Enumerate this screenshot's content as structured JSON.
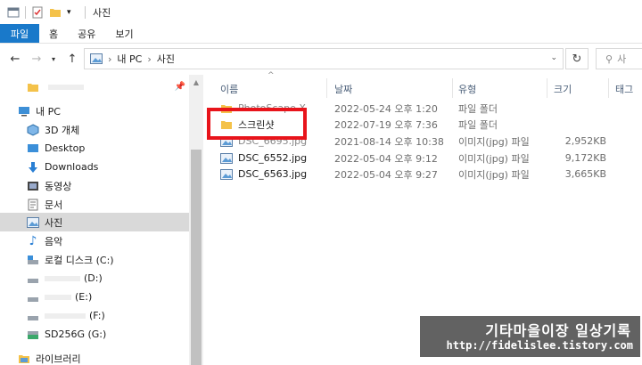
{
  "window": {
    "title": "사진"
  },
  "ribbon": {
    "tabs": [
      "파일",
      "홈",
      "공유",
      "보기"
    ]
  },
  "address": {
    "path": [
      "내 PC",
      "사진"
    ],
    "search_placeholder": "사"
  },
  "nav": {
    "items": [
      {
        "label": "",
        "icon": "folder-icon",
        "pinned": true
      },
      {
        "label": "내 PC",
        "icon": "pc-icon"
      },
      {
        "label": "3D 개체",
        "icon": "3d-objects-icon"
      },
      {
        "label": "Desktop",
        "icon": "desktop-icon"
      },
      {
        "label": "Downloads",
        "icon": "download-icon"
      },
      {
        "label": "동영상",
        "icon": "video-icon"
      },
      {
        "label": "문서",
        "icon": "document-icon"
      },
      {
        "label": "사진",
        "icon": "pictures-icon",
        "selected": true
      },
      {
        "label": "음악",
        "icon": "music-icon"
      },
      {
        "label": "로컬 디스크 (C:)",
        "icon": "drive-icon"
      },
      {
        "label": "(D:)",
        "icon": "drive-icon"
      },
      {
        "label": "(E:)",
        "icon": "drive-icon"
      },
      {
        "label": "(F:)",
        "icon": "drive-icon"
      },
      {
        "label": "SD256G (G:)",
        "icon": "sd-drive-icon"
      },
      {
        "label": "라이브러리",
        "icon": "library-icon"
      }
    ]
  },
  "columns": {
    "name": "이름",
    "date": "날짜",
    "type": "유형",
    "size": "크기",
    "tags": "태그"
  },
  "files": [
    {
      "name": "PhotoScape X",
      "date": "2022-05-24 오후 1:20",
      "type": "파일 폴더",
      "size": "",
      "icon": "folder-icon"
    },
    {
      "name": "스크린샷",
      "date": "2022-07-19 오후 7:36",
      "type": "파일 폴더",
      "size": "",
      "icon": "folder-icon"
    },
    {
      "name": "DSC_6695.jpg",
      "date": "2021-08-14 오후 10:38",
      "type": "이미지(jpg) 파일",
      "size": "2,952KB",
      "icon": "image-file-icon"
    },
    {
      "name": "DSC_6552.jpg",
      "date": "2022-05-04 오후 9:12",
      "type": "이미지(jpg) 파일",
      "size": "9,172KB",
      "icon": "image-file-icon"
    },
    {
      "name": "DSC_6563.jpg",
      "date": "2022-05-04 오후 9:27",
      "type": "이미지(jpg) 파일",
      "size": "3,665KB",
      "icon": "image-file-icon"
    }
  ],
  "watermark": {
    "title": "기타마을이장 일상기록",
    "url": "http://fidelislee.tistory.com"
  },
  "colors": {
    "accent": "#1979ca",
    "highlight": "#e8141b",
    "folder": "#f4c24a"
  }
}
